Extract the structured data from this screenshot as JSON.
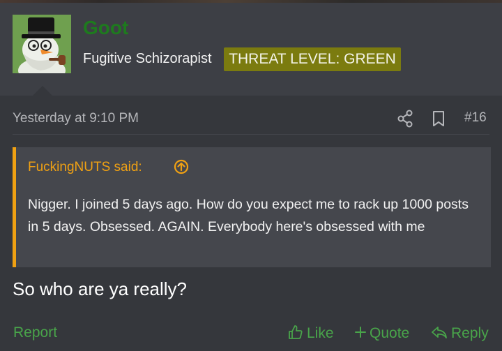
{
  "user": {
    "name": "Goot",
    "title": "Fugitive Schizorapist",
    "banner": "THREAT LEVEL: GREEN"
  },
  "post": {
    "date": "Yesterday at 9:10 PM",
    "number": "#16",
    "body": "So who are ya really?"
  },
  "quote": {
    "author": "FuckingNUTS said:",
    "text": "Nigger. I joined 5 days ago. How do you expect me to rack up 1000 posts in 5 days. Obsessed. AGAIN. Everybody here's obsessed with me"
  },
  "actions": {
    "report": "Report",
    "like": "Like",
    "quote": "Quote",
    "reply": "Reply"
  },
  "icons": {
    "share": "share-icon",
    "bookmark": "bookmark-icon",
    "quote_jump": "arrow-up-circle-icon",
    "like": "thumbs-up-icon",
    "quote": "plus-icon",
    "reply": "reply-arrow-icon"
  },
  "colors": {
    "username": "#1e7a1e",
    "banner_bg": "#7b7b0f",
    "quote_accent": "#f0a113",
    "action_green": "#49a44a",
    "background": "#35373c"
  }
}
